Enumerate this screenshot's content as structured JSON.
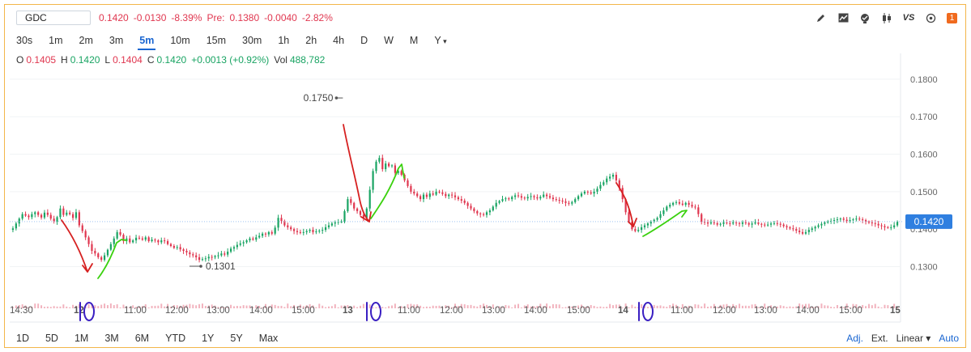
{
  "quote": {
    "symbol": "GDC",
    "last": "0.1420",
    "change": "-0.0130",
    "change_pct": "-8.39%",
    "pre_label": "Pre:",
    "pre_price": "0.1380",
    "pre_change": "-0.0040",
    "pre_change_pct": "-2.82%"
  },
  "toolbar": {
    "icons": [
      "draw-icon",
      "chart-type-icon",
      "indicators-icon",
      "candles-icon",
      "compare-icon",
      "settings-icon",
      "alert-icon"
    ],
    "compare_label": "VS",
    "badge": "1"
  },
  "intervals": [
    "30s",
    "1m",
    "2m",
    "3m",
    "5m",
    "10m",
    "15m",
    "30m",
    "1h",
    "2h",
    "4h",
    "D",
    "W",
    "M",
    "Y"
  ],
  "active_interval": "5m",
  "ohlc": {
    "o_label": "O",
    "o": "0.1405",
    "h_label": "H",
    "h": "0.1420",
    "l_label": "L",
    "l": "0.1404",
    "c_label": "C",
    "c": "0.1420",
    "change": "+0.0013 (+0.92%)",
    "vol_label": "Vol",
    "vol": "488,782"
  },
  "ranges": [
    "1D",
    "5D",
    "1M",
    "3M",
    "6M",
    "YTD",
    "1Y",
    "5Y",
    "Max"
  ],
  "options": {
    "adj": "Adj.",
    "ext": "Ext.",
    "scale": "Linear",
    "auto": "Auto"
  },
  "colors": {
    "up": "#19a463",
    "down": "#e0364f",
    "volume": "#f2b3be",
    "annotation_red": "#d62020",
    "annotation_green": "#3bd10f",
    "annotation_blue": "#3a1fc2"
  },
  "chart_data": {
    "type": "candlestick",
    "y_ticks": [
      "0.1800",
      "0.1700",
      "0.1600",
      "0.1500",
      "0.1400",
      "0.1300"
    ],
    "ylim": [
      0.126,
      0.183
    ],
    "last_price_label": "0.1420",
    "last_price": 0.142,
    "max_label": "0.1750",
    "max_value": 0.175,
    "min_label": "0.1301",
    "min_value": 0.1301,
    "x_ticks": [
      "14:30",
      "12",
      "11:00",
      "12:00",
      "13:00",
      "14:00",
      "15:00",
      "13",
      "11:00",
      "12:00",
      "13:00",
      "14:00",
      "15:00",
      "14",
      "11:00",
      "12:00",
      "13:00",
      "14:00",
      "15:00",
      "15"
    ],
    "series": [
      {
        "session": "day-11",
        "close": [
          0.1402,
          0.1415,
          0.1428,
          0.144,
          0.1436,
          0.1432,
          0.144,
          0.1445,
          0.1438,
          0.1431,
          0.1444,
          0.1438,
          0.1428,
          0.142,
          0.1432,
          0.1455,
          0.1438,
          0.1444
        ]
      },
      {
        "session": "day-12",
        "close": [
          0.144,
          0.143,
          0.1445,
          0.141,
          0.1395,
          0.1378,
          0.136,
          0.1342,
          0.1335,
          0.1325,
          0.1318,
          0.133,
          0.1345,
          0.136,
          0.1375,
          0.1392,
          0.1385,
          0.1368,
          0.1375,
          0.1365,
          0.137,
          0.1377,
          0.1375,
          0.1372,
          0.1378,
          0.1368,
          0.1372,
          0.137,
          0.1365,
          0.137,
          0.1368,
          0.136,
          0.1355,
          0.135,
          0.1352,
          0.1346,
          0.1342,
          0.1338,
          0.1333,
          0.133,
          0.1325,
          0.1318,
          0.132,
          0.1322,
          0.1326,
          0.1325,
          0.1328,
          0.133,
          0.1335,
          0.1332,
          0.134,
          0.1348,
          0.1352,
          0.1358,
          0.1362,
          0.1365,
          0.137,
          0.1375,
          0.1372,
          0.1378,
          0.1382,
          0.1388,
          0.1386,
          0.1392,
          0.1388,
          0.1404,
          0.143,
          0.1422,
          0.141,
          0.1405,
          0.14,
          0.1395,
          0.1392,
          0.139,
          0.1392,
          0.1395,
          0.1398,
          0.1392,
          0.1394,
          0.1396,
          0.1398,
          0.1405,
          0.141,
          0.1415,
          0.1418,
          0.142
        ]
      },
      {
        "session": "day-13",
        "close": [
          0.142,
          0.1448,
          0.148,
          0.147,
          0.1455,
          0.1448,
          0.1438,
          0.143,
          0.1455,
          0.1505,
          0.1555,
          0.158,
          0.159,
          0.156,
          0.1575,
          0.1568,
          0.157,
          0.155,
          0.1555,
          0.1545,
          0.153,
          0.1515,
          0.15,
          0.1495,
          0.1488,
          0.148,
          0.1492,
          0.1486,
          0.1495,
          0.1492,
          0.15,
          0.1498,
          0.1494,
          0.1488,
          0.1492,
          0.149,
          0.1485,
          0.148,
          0.1476,
          0.147,
          0.1462,
          0.1455,
          0.1448,
          0.1442,
          0.144,
          0.1438,
          0.1445,
          0.145,
          0.146,
          0.147,
          0.1475,
          0.148,
          0.1482,
          0.148,
          0.1486,
          0.149,
          0.1488,
          0.1484,
          0.1482,
          0.1486,
          0.1488,
          0.1485,
          0.1482,
          0.1486,
          0.1492,
          0.1488,
          0.1484,
          0.148,
          0.1478,
          0.1476,
          0.1474,
          0.147,
          0.1468,
          0.1472,
          0.148,
          0.1488,
          0.1495,
          0.15,
          0.1498,
          0.1495,
          0.15,
          0.1508,
          0.1518,
          0.1525,
          0.1535,
          0.154,
          0.1545,
          0.153
        ]
      },
      {
        "session": "day-14",
        "close": [
          0.151,
          0.148,
          0.1445,
          0.142,
          0.14,
          0.1395,
          0.1398,
          0.1405,
          0.141,
          0.1415,
          0.142,
          0.1425,
          0.143,
          0.144,
          0.145,
          0.146,
          0.1465,
          0.147,
          0.1472,
          0.1468,
          0.1465,
          0.147,
          0.1465,
          0.146,
          0.1458,
          0.144,
          0.142,
          0.1418,
          0.1415,
          0.1418,
          0.1416,
          0.1412,
          0.1414,
          0.1418,
          0.1416,
          0.1415,
          0.1418,
          0.1416,
          0.1414,
          0.1418,
          0.1416,
          0.1412,
          0.1415,
          0.1418,
          0.1414,
          0.1412,
          0.141,
          0.1412,
          0.1415,
          0.1416,
          0.1414,
          0.1412,
          0.1408,
          0.1405,
          0.1402,
          0.14,
          0.1396,
          0.1392,
          0.1388,
          0.1392,
          0.1398,
          0.1402,
          0.1406,
          0.141,
          0.1414,
          0.1418,
          0.142,
          0.1422,
          0.1424,
          0.1426,
          0.1428,
          0.1425,
          0.1422,
          0.1424,
          0.1426,
          0.1428,
          0.1426,
          0.1424,
          0.142,
          0.1418,
          0.1416,
          0.1414,
          0.141,
          0.1408,
          0.1405,
          0.1404,
          0.1405,
          0.141,
          0.142
        ]
      }
    ]
  }
}
